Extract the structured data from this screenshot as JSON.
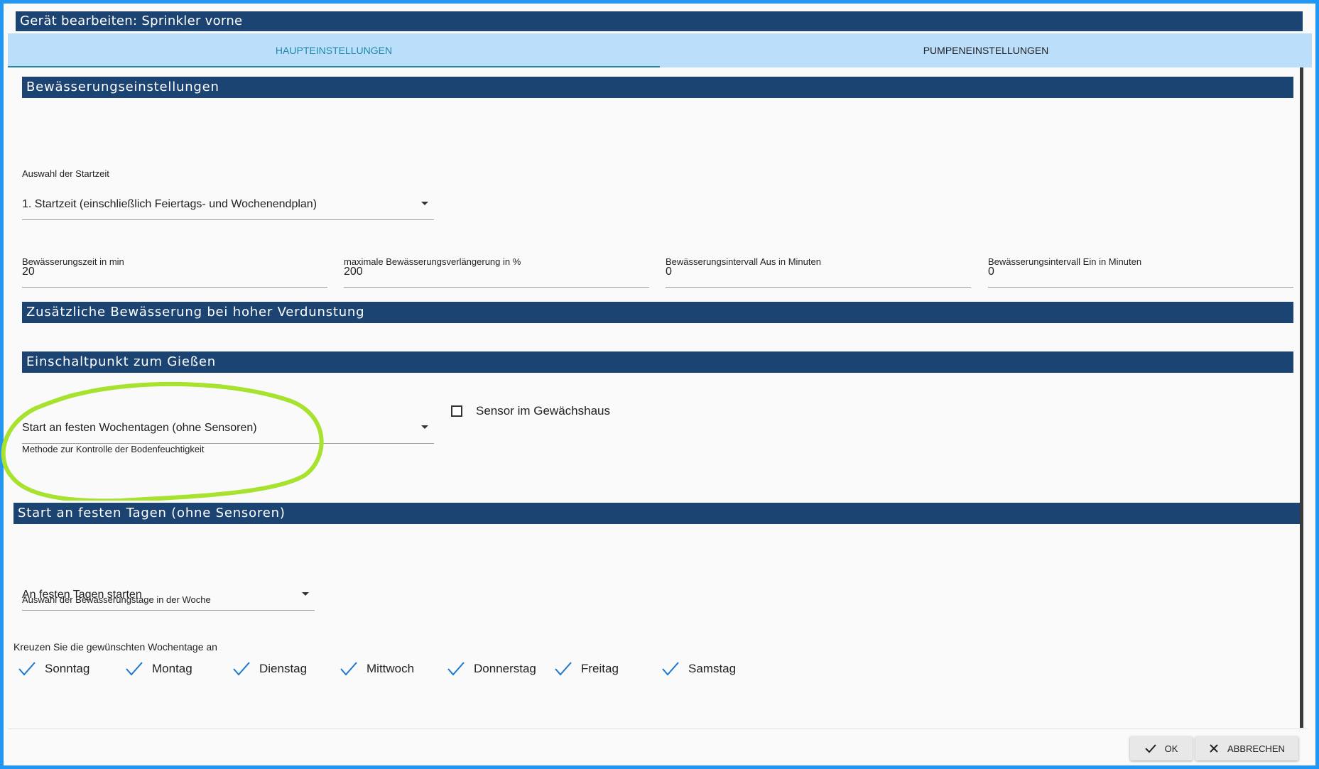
{
  "dialog": {
    "title": "Gerät bearbeiten: Sprinkler vorne"
  },
  "tabs": [
    {
      "label": "HAUPTEINSTELLUNGEN",
      "active": true
    },
    {
      "label": "PUMPENEINSTELLUNGEN",
      "active": false
    }
  ],
  "sections": {
    "irrigation": "Bewässerungseinstellungen",
    "extra": "Zusätzliche Bewässerung bei hoher Verdunstung",
    "switch_point": "Einschaltpunkt zum Gießen",
    "fixed_days": "Start an festen Tagen (ohne Sensoren)"
  },
  "start_time": {
    "value": "1. Startzeit (einschließlich Feiertags- und Wochenendplan)",
    "helper": "Auswahl der Startzeit"
  },
  "numeric_fields": [
    {
      "value": "20",
      "helper": "Bewässerungszeit in min"
    },
    {
      "value": "200",
      "helper": "maximale Bewässerungsverlängerung in %"
    },
    {
      "value": "0",
      "helper": "Bewässerungsintervall Aus in Minuten"
    },
    {
      "value": "0",
      "helper": "Bewässerungsintervall Ein in Minuten"
    }
  ],
  "method": {
    "value": "Start an festen Wochentagen (ohne Sensoren)",
    "helper": "Methode zur Kontrolle der Bodenfeuchtigkeit"
  },
  "greenhouse": {
    "label": "Sensor im Gewächshaus",
    "checked": false
  },
  "days_mode": {
    "value": "An festen Tagen starten",
    "helper": "Auswahl der Bewässerungstage in der Woche"
  },
  "weekdays": {
    "prompt": "Kreuzen Sie die gewünschten Wochentage an",
    "items": [
      {
        "label": "Sonntag",
        "checked": true
      },
      {
        "label": "Montag",
        "checked": true
      },
      {
        "label": "Dienstag",
        "checked": true
      },
      {
        "label": "Mittwoch",
        "checked": true
      },
      {
        "label": "Donnerstag",
        "checked": true
      },
      {
        "label": "Freitag",
        "checked": true
      },
      {
        "label": "Samstag",
        "checked": true
      }
    ]
  },
  "buttons": {
    "ok": "OK",
    "cancel": "ABBRECHEN"
  },
  "colors": {
    "border": "#2196f3",
    "section_header": "#1c4473",
    "tab_bar": "#bbdefb",
    "tab_active": "#1e88a8",
    "check": "#1976d2",
    "annotation": "#a6e22e"
  },
  "icons": {
    "dropdown": "arrow-drop-down-icon",
    "day_check": "checkmark-icon",
    "ok": "checkmark-icon",
    "cancel": "close-icon"
  }
}
